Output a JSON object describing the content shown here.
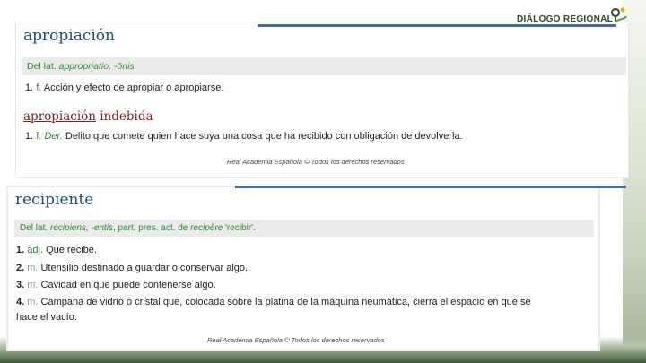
{
  "header": {
    "org": "DIÁLOGO REGIONAL"
  },
  "entry1": {
    "headword": "apropiación",
    "etymology_prefix": "Del lat. ",
    "etymology_italic": "appropriatio, -ōnis.",
    "senses": [
      {
        "num": "1.",
        "gram": "f.",
        "text": "Acción y efecto de apropiar o apropiarse."
      }
    ],
    "subentry": {
      "headword": "apropiación",
      "qualifier": " indebida",
      "num": "1.",
      "gram": "f.",
      "field": "Der.",
      "text": "Delito que comete quien hace suya una cosa que ha recibido con obligación de devolverla."
    },
    "footer": "Real Academia Española © Todos los derechos reservados"
  },
  "entry2": {
    "headword": "recipiente",
    "etymology": {
      "p1": "Del lat. ",
      "i1": "recipiens, -entis",
      "p2": ", part. pres. act. de ",
      "i2": "recipĕre",
      "p3": " 'recibir'."
    },
    "senses": [
      {
        "num": "1.",
        "gram": "adj.",
        "text": "Que recibe."
      },
      {
        "num": "2.",
        "gram": "m.",
        "text": "Utensilio destinado a guardar o conservar algo."
      },
      {
        "num": "3.",
        "gram": "m.",
        "text": "Cavidad en que puede contenerse algo."
      },
      {
        "num": "4.",
        "gram": "m.",
        "text": "Campana de vidrio o cristal que, colocada sobre la platina de la máquina neumática, cierra el espacio en que se"
      }
    ],
    "sense4_cont": "hace el vacío.",
    "footer": "Real Academia Española © Todos los derechos reservados"
  },
  "colors": {
    "title_blue": "#1f4e79",
    "etym_green": "#2b8a2b",
    "sub_red": "#8b1a1a",
    "bar_blue": "#3a6ea5"
  }
}
